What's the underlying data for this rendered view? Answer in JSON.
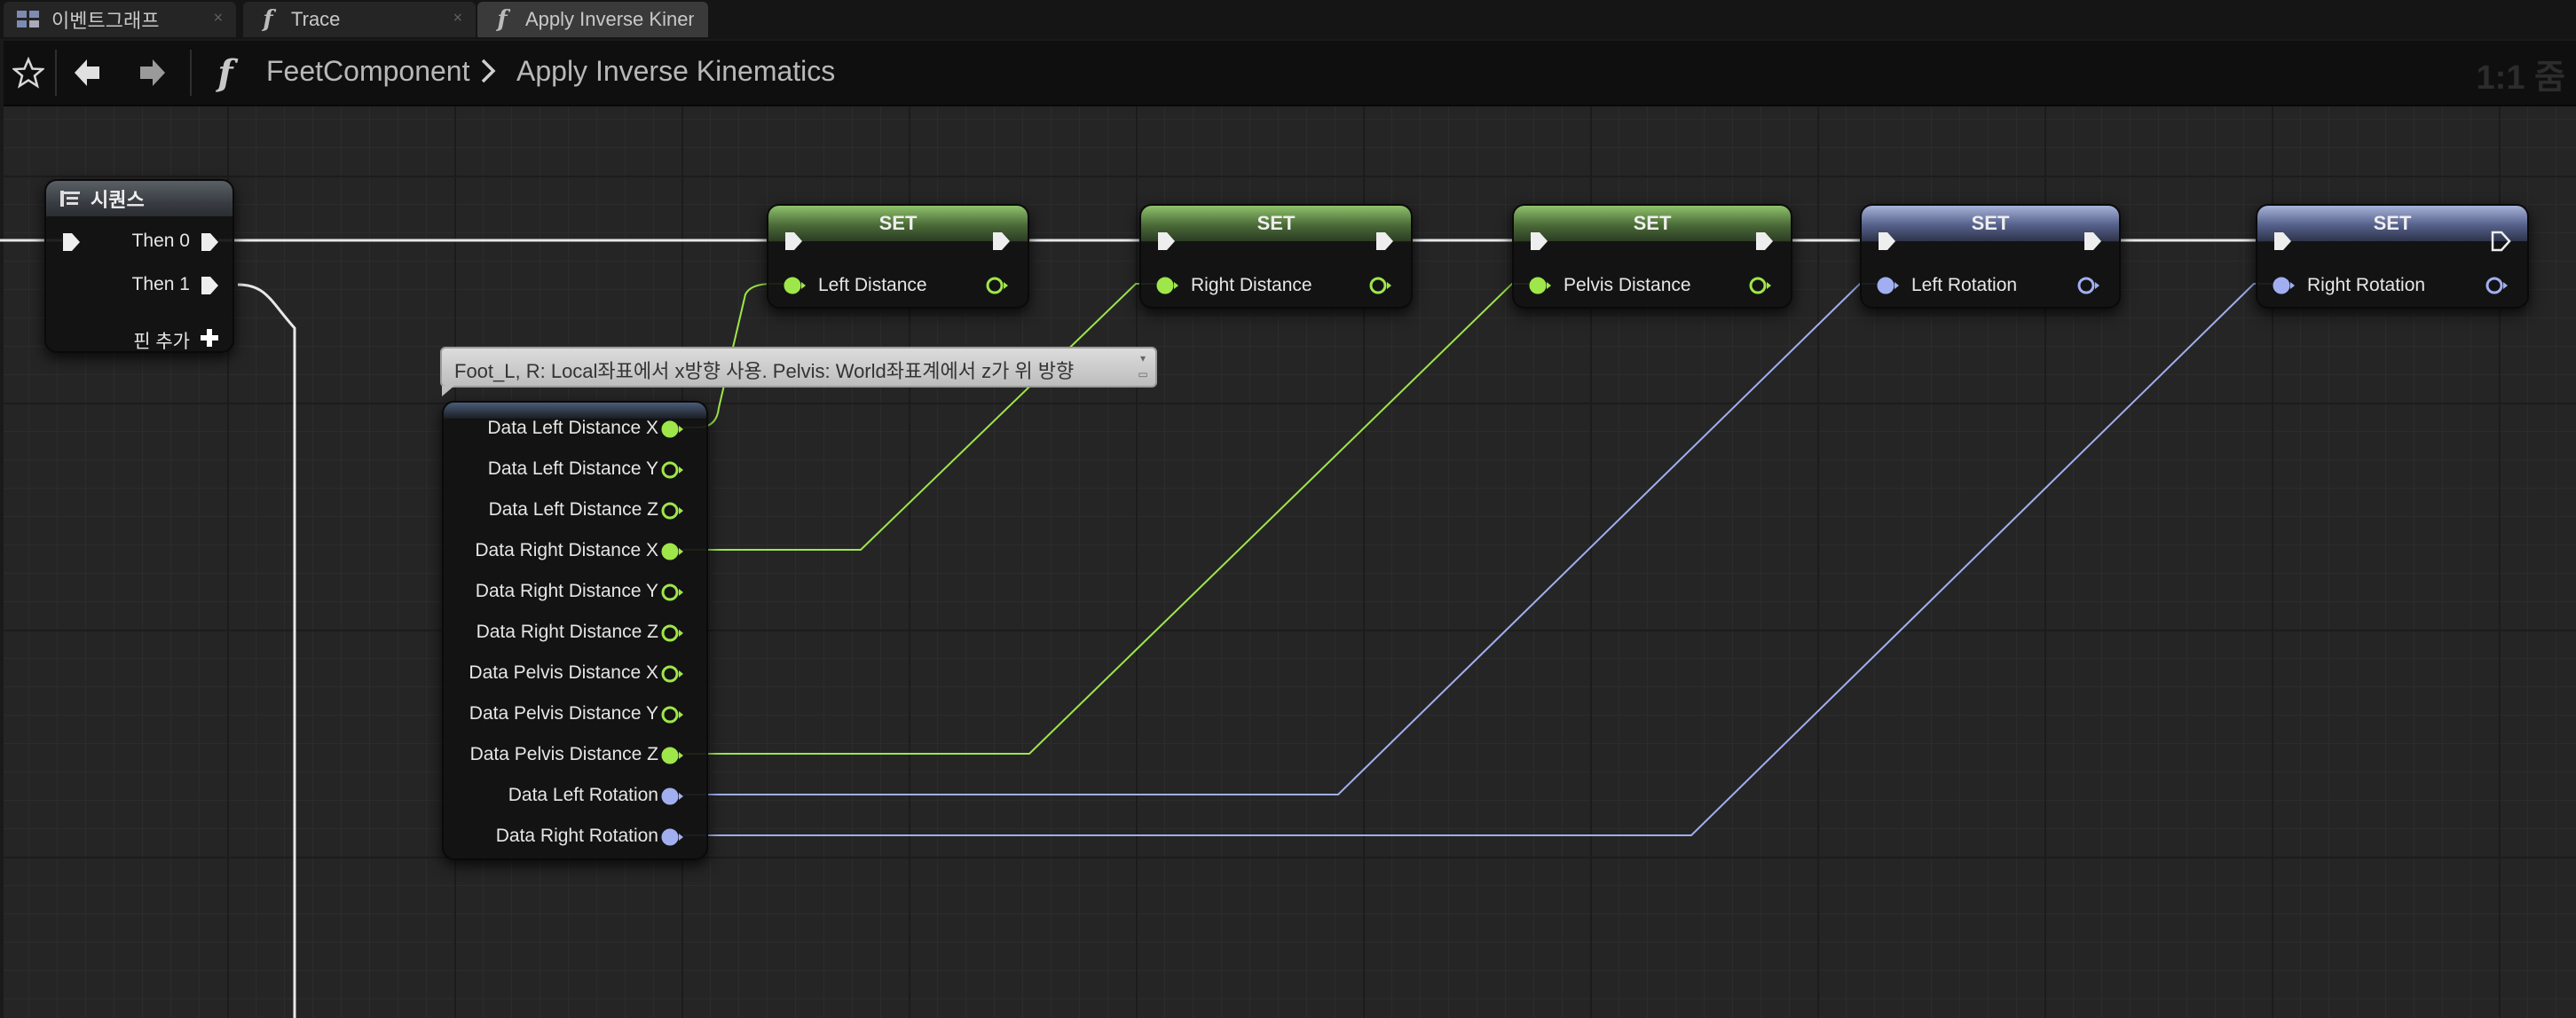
{
  "tabs": [
    {
      "label": "이벤트그래프",
      "icon": "event-graph-icon"
    },
    {
      "label": "Trace",
      "icon": "function-icon"
    },
    {
      "label": "Apply Inverse Kinematics",
      "icon": "function-icon"
    }
  ],
  "breadcrumb": {
    "root": "FeetComponent",
    "separator": ">",
    "current": "Apply Inverse Kinematics",
    "zoom": "1:1 줌"
  },
  "colors": {
    "exec_wire": "#e8e8e8",
    "float_pin": "#9fe64a",
    "rotator_pin": "#a1aff1",
    "background": "#252525"
  },
  "sequence_node": {
    "title": "시퀀스",
    "then0": "Then 0",
    "then1": "Then 1",
    "add_pin": "핀 추가"
  },
  "comment": "Foot_L, R: Local좌표에서 x방향 사용. Pelvis: World좌표계에서 z가 위 방향",
  "break_node": {
    "outputs": [
      {
        "label": "Data Left Distance X",
        "type": "float",
        "connected": true
      },
      {
        "label": "Data Left Distance Y",
        "type": "float",
        "connected": false
      },
      {
        "label": "Data Left Distance Z",
        "type": "float",
        "connected": false
      },
      {
        "label": "Data Right Distance X",
        "type": "float",
        "connected": true
      },
      {
        "label": "Data Right Distance Y",
        "type": "float",
        "connected": false
      },
      {
        "label": "Data Right Distance Z",
        "type": "float",
        "connected": false
      },
      {
        "label": "Data Pelvis Distance X",
        "type": "float",
        "connected": false
      },
      {
        "label": "Data Pelvis Distance Y",
        "type": "float",
        "connected": false
      },
      {
        "label": "Data Pelvis Distance Z",
        "type": "float",
        "connected": true
      },
      {
        "label": "Data Left Rotation",
        "type": "rotator",
        "connected": true
      },
      {
        "label": "Data Right Rotation",
        "type": "rotator",
        "connected": true
      }
    ]
  },
  "set_nodes": [
    {
      "title": "SET",
      "variable": "Left Distance",
      "type": "float"
    },
    {
      "title": "SET",
      "variable": "Right Distance",
      "type": "float"
    },
    {
      "title": "SET",
      "variable": "Pelvis Distance",
      "type": "float"
    },
    {
      "title": "SET",
      "variable": "Left Rotation",
      "type": "rotator"
    },
    {
      "title": "SET",
      "variable": "Right Rotation",
      "type": "rotator"
    }
  ]
}
